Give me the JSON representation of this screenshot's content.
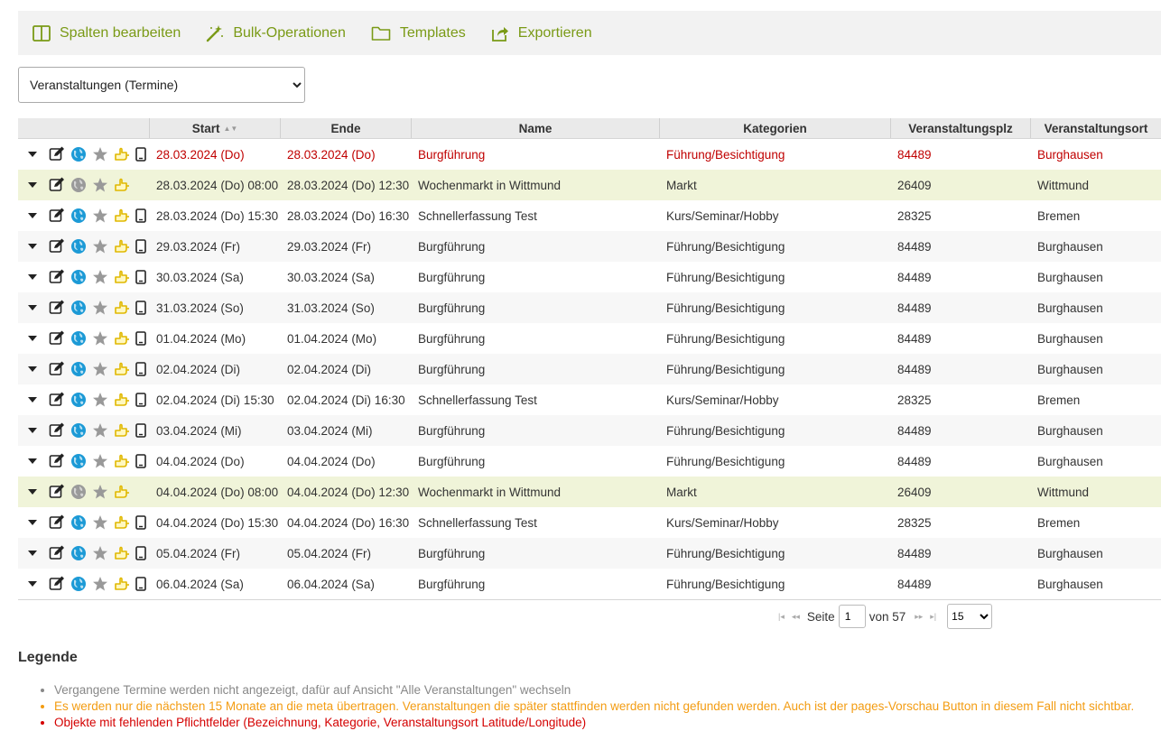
{
  "toolbar": {
    "edit_columns": "Spalten bearbeiten",
    "bulk_operations": "Bulk-Operationen",
    "templates": "Templates",
    "export": "Exportieren"
  },
  "view_select": {
    "selected": "Veranstaltungen (Termine)"
  },
  "colors": {
    "accent": "#7a9a16",
    "past": "#c00000",
    "highlight_row": "#f0f4d9",
    "legend_gray": "#888888",
    "legend_orange": "#f39c12",
    "legend_red": "#d40000"
  },
  "table": {
    "columns": [
      "Start",
      "Ende",
      "Name",
      "Kategorien",
      "Veranstaltungsplz",
      "Veranstaltungsort"
    ],
    "sort_indicator": "▲▼",
    "rows": [
      {
        "start": "28.03.2024 (Do)",
        "end": "28.03.2024 (Do)",
        "name": "Burgführung",
        "category": "Führung/Besichtigung",
        "plz": "84489",
        "ort": "Burghausen",
        "past": true,
        "highlight": false,
        "globe": "blue",
        "mobile": true
      },
      {
        "start": "28.03.2024 (Do) 08:00",
        "end": "28.03.2024 (Do) 12:30",
        "name": "Wochenmarkt in Wittmund",
        "category": "Markt",
        "plz": "26409",
        "ort": "Wittmund",
        "past": false,
        "highlight": true,
        "globe": "gray",
        "mobile": false
      },
      {
        "start": "28.03.2024 (Do) 15:30",
        "end": "28.03.2024 (Do) 16:30",
        "name": "Schnellerfassung Test",
        "category": "Kurs/Seminar/Hobby",
        "plz": "28325",
        "ort": "Bremen",
        "past": false,
        "highlight": false,
        "globe": "blue",
        "mobile": true
      },
      {
        "start": "29.03.2024 (Fr)",
        "end": "29.03.2024 (Fr)",
        "name": "Burgführung",
        "category": "Führung/Besichtigung",
        "plz": "84489",
        "ort": "Burghausen",
        "past": false,
        "highlight": false,
        "globe": "blue",
        "mobile": true
      },
      {
        "start": "30.03.2024 (Sa)",
        "end": "30.03.2024 (Sa)",
        "name": "Burgführung",
        "category": "Führung/Besichtigung",
        "plz": "84489",
        "ort": "Burghausen",
        "past": false,
        "highlight": false,
        "globe": "blue",
        "mobile": true
      },
      {
        "start": "31.03.2024 (So)",
        "end": "31.03.2024 (So)",
        "name": "Burgführung",
        "category": "Führung/Besichtigung",
        "plz": "84489",
        "ort": "Burghausen",
        "past": false,
        "highlight": false,
        "globe": "blue",
        "mobile": true
      },
      {
        "start": "01.04.2024 (Mo)",
        "end": "01.04.2024 (Mo)",
        "name": "Burgführung",
        "category": "Führung/Besichtigung",
        "plz": "84489",
        "ort": "Burghausen",
        "past": false,
        "highlight": false,
        "globe": "blue",
        "mobile": true
      },
      {
        "start": "02.04.2024 (Di)",
        "end": "02.04.2024 (Di)",
        "name": "Burgführung",
        "category": "Führung/Besichtigung",
        "plz": "84489",
        "ort": "Burghausen",
        "past": false,
        "highlight": false,
        "globe": "blue",
        "mobile": true
      },
      {
        "start": "02.04.2024 (Di) 15:30",
        "end": "02.04.2024 (Di) 16:30",
        "name": "Schnellerfassung Test",
        "category": "Kurs/Seminar/Hobby",
        "plz": "28325",
        "ort": "Bremen",
        "past": false,
        "highlight": false,
        "globe": "blue",
        "mobile": true
      },
      {
        "start": "03.04.2024 (Mi)",
        "end": "03.04.2024 (Mi)",
        "name": "Burgführung",
        "category": "Führung/Besichtigung",
        "plz": "84489",
        "ort": "Burghausen",
        "past": false,
        "highlight": false,
        "globe": "blue",
        "mobile": true
      },
      {
        "start": "04.04.2024 (Do)",
        "end": "04.04.2024 (Do)",
        "name": "Burgführung",
        "category": "Führung/Besichtigung",
        "plz": "84489",
        "ort": "Burghausen",
        "past": false,
        "highlight": false,
        "globe": "blue",
        "mobile": true
      },
      {
        "start": "04.04.2024 (Do) 08:00",
        "end": "04.04.2024 (Do) 12:30",
        "name": "Wochenmarkt in Wittmund",
        "category": "Markt",
        "plz": "26409",
        "ort": "Wittmund",
        "past": false,
        "highlight": true,
        "globe": "gray",
        "mobile": false
      },
      {
        "start": "04.04.2024 (Do) 15:30",
        "end": "04.04.2024 (Do) 16:30",
        "name": "Schnellerfassung Test",
        "category": "Kurs/Seminar/Hobby",
        "plz": "28325",
        "ort": "Bremen",
        "past": false,
        "highlight": false,
        "globe": "blue",
        "mobile": true
      },
      {
        "start": "05.04.2024 (Fr)",
        "end": "05.04.2024 (Fr)",
        "name": "Burgführung",
        "category": "Führung/Besichtigung",
        "plz": "84489",
        "ort": "Burghausen",
        "past": false,
        "highlight": false,
        "globe": "blue",
        "mobile": true
      },
      {
        "start": "06.04.2024 (Sa)",
        "end": "06.04.2024 (Sa)",
        "name": "Burgführung",
        "category": "Führung/Besichtigung",
        "plz": "84489",
        "ort": "Burghausen",
        "past": false,
        "highlight": false,
        "globe": "blue",
        "mobile": true
      }
    ]
  },
  "pager": {
    "first": "|◂",
    "prev": "◂◂",
    "page_label": "Seite",
    "page_value": "1",
    "of_label": "von 57",
    "next": "▸▸",
    "last": "▸|",
    "page_size": "15"
  },
  "legend": {
    "title": "Legende",
    "items": [
      {
        "text": "Vergangene Termine werden nicht angezeigt, dafür auf Ansicht \"Alle Veranstaltungen\" wechseln",
        "color": "#888888"
      },
      {
        "text": "Es werden nur die nächsten 15 Monate an die meta übertragen. Veranstaltungen die später stattfinden werden nicht gefunden werden. Auch ist der pages-Vorschau Button in diesem Fall nicht sichtbar.",
        "color": "#f39c12"
      },
      {
        "text": "Objekte mit fehlenden Pflichtfelder (Bezeichnung, Kategorie, Veranstaltungsort Latitude/Longitude)",
        "color": "#d40000"
      }
    ]
  }
}
